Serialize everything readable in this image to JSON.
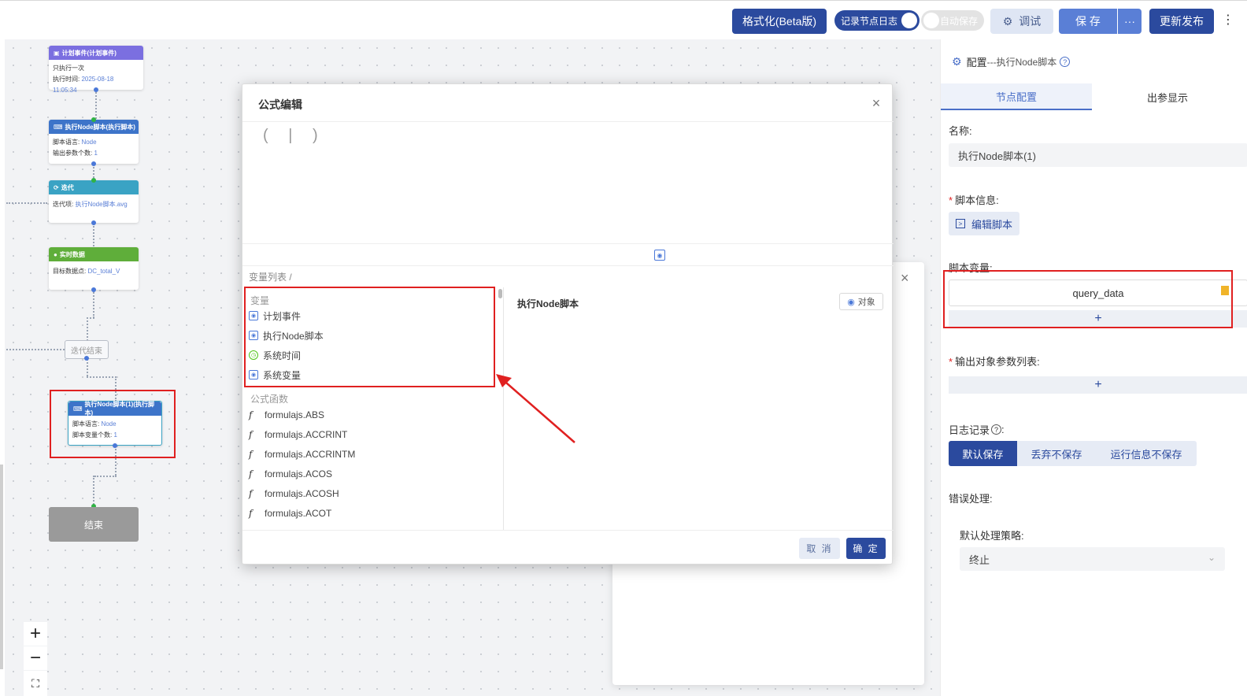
{
  "toolbar": {
    "format_label": "格式化(Beta版)",
    "log_toggle_label": "记录节点日志",
    "autosave_label": "自动保存",
    "debug_label": "调试",
    "save_label": "保 存",
    "more_label": "···",
    "publish_label": "更新发布",
    "overflow_label": "⋮"
  },
  "flow": {
    "nodes": [
      {
        "title": "计划事件(计划事件)",
        "lines": [
          "只执行一次"
        ],
        "extra_key": "执行时间: ",
        "extra_val": "2025-08-18 11:05:34",
        "color": "#7b6fe0"
      },
      {
        "title": "执行Node脚本(执行脚本)",
        "key1": "脚本语言: ",
        "val1": "Node",
        "key2": "输出参数个数: ",
        "val2": "1",
        "color": "#3d74c9"
      },
      {
        "title": "迭代",
        "key1": "迭代项: ",
        "val1": "执行Node脚本.avg",
        "color": "#3aa3c4"
      },
      {
        "title": "实时数据",
        "key1": "目标数据点: ",
        "val1": "DC_total_V",
        "color": "#5fae3a"
      },
      {
        "title": "执行Node脚本(1)(执行脚本)",
        "key1": "脚本语言: ",
        "val1": "Node",
        "key2": "脚本变量个数: ",
        "val2": "1",
        "color": "#3d74c9"
      }
    ],
    "iter_end_label": "迭代结束",
    "end_label": "结束",
    "zoom_in": "+",
    "zoom_out": "−"
  },
  "formula_dialog": {
    "title": "公式编辑",
    "close": "×",
    "editor_parens": "( | )",
    "breadcrumb": "变量列表  /",
    "variables_section": "变量",
    "variables": [
      {
        "label": "计划事件",
        "icon": "object-icon"
      },
      {
        "label": "执行Node脚本",
        "icon": "object-icon"
      },
      {
        "label": "系统时间",
        "icon": "clock-icon"
      },
      {
        "label": "系统变量",
        "icon": "object-icon"
      }
    ],
    "functions_section": "公式函数",
    "functions": [
      "formulajs.ABS",
      "formulajs.ACCRINT",
      "formulajs.ACCRINTM",
      "formulajs.ACOS",
      "formulajs.ACOSH",
      "formulajs.ACOT"
    ],
    "detail_title": "执行Node脚本",
    "object_badge": "对象",
    "cancel": "取 消",
    "ok": "确 定"
  },
  "bg_dialog": {
    "close": "×"
  },
  "panel": {
    "title": "配置",
    "subtitle": "---执行Node脚本",
    "tab_active": "节点配置",
    "tab_inactive": "出参显示",
    "name_label": "名称:",
    "name_value": "执行Node脚本(1)",
    "script_info_label": "脚本信息:",
    "edit_script": "编辑脚本",
    "script_var_label": "脚本变量:",
    "script_var_value": "query_data",
    "add": "+",
    "output_label": "输出对象参数列表:",
    "log_label": "日志记录",
    "log_options": [
      "默认保存",
      "丢弃不保存",
      "运行信息不保存"
    ],
    "error_label": "错误处理:",
    "strategy_label": "默认处理策略:",
    "strategy_value": "终止"
  },
  "colors": {
    "primary": "#2b4a9e",
    "accent": "#5a7fd6",
    "highlight": "#e02020"
  }
}
